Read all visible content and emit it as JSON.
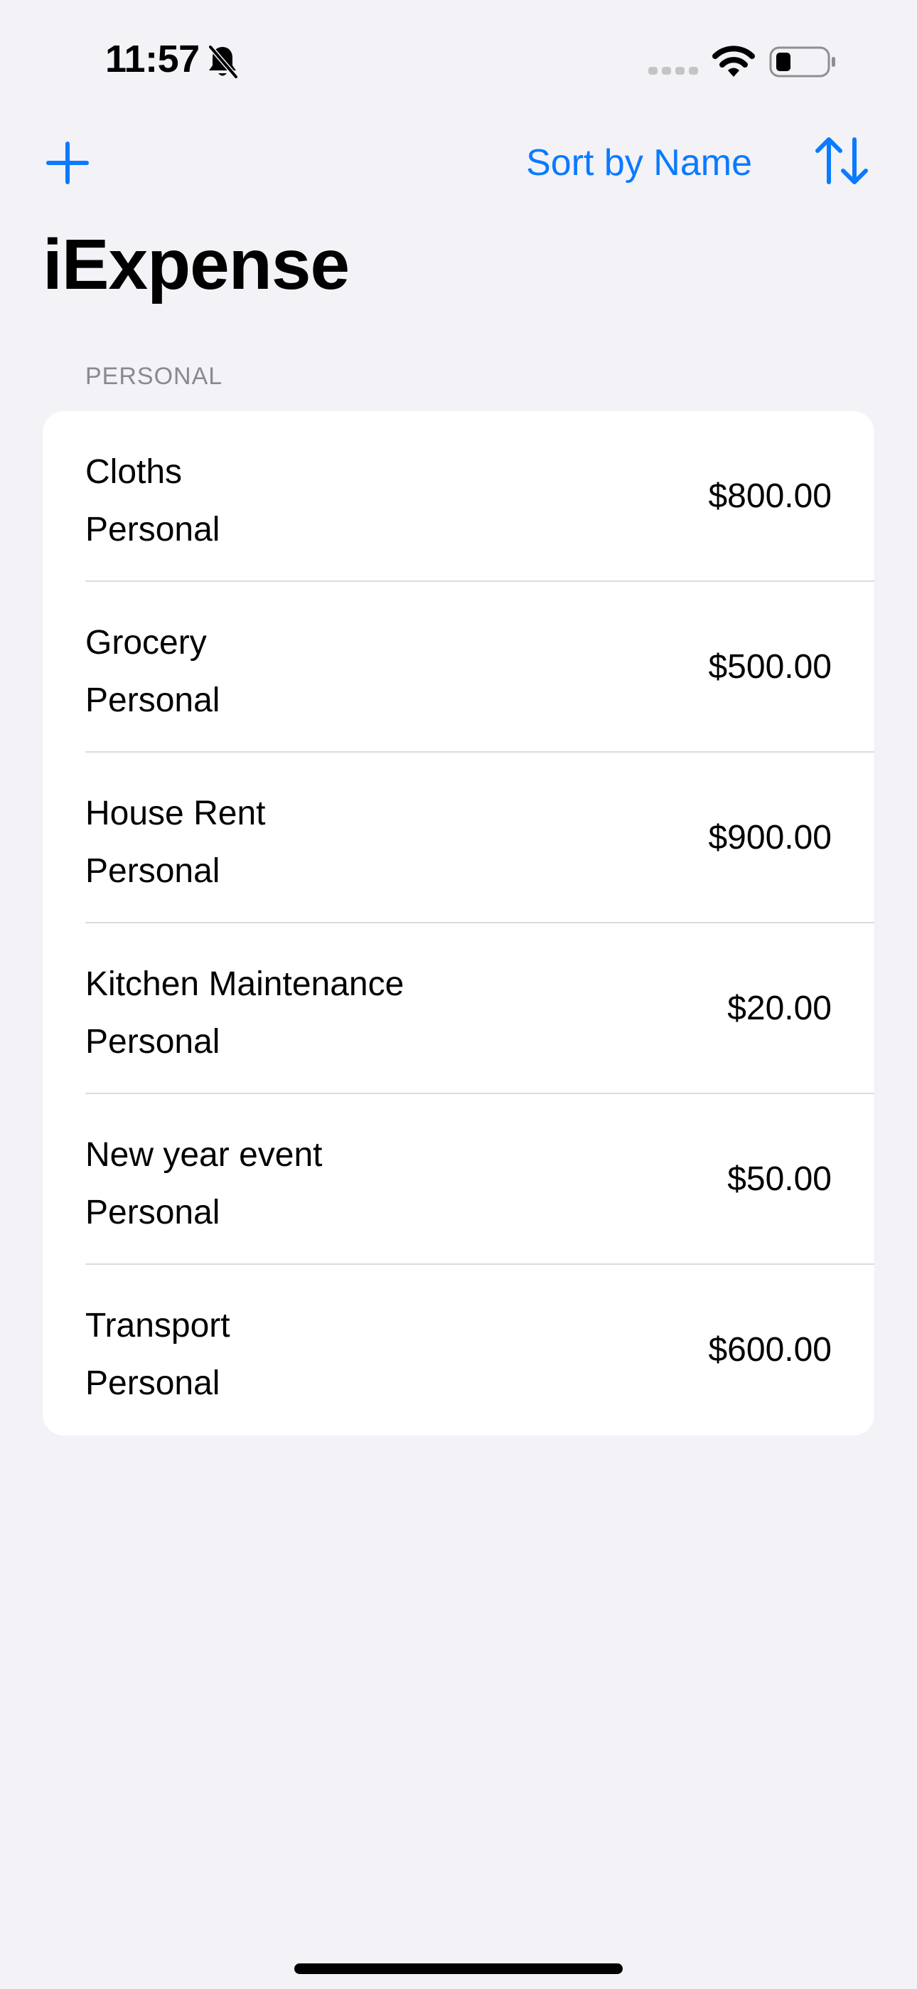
{
  "status_bar": {
    "time": "11:57",
    "icons": [
      "bell-slash-icon",
      "cellular-signal-icon",
      "wifi-icon",
      "battery-icon"
    ]
  },
  "nav": {
    "add_icon": "plus-icon",
    "sort_label": "Sort by Name",
    "sort_order_icon": "sort-up-down-arrows-icon",
    "title": "iExpense"
  },
  "section": {
    "header": "PERSONAL",
    "items": [
      {
        "name": "Cloths",
        "type": "Personal",
        "amount": "$800.00"
      },
      {
        "name": "Grocery",
        "type": "Personal",
        "amount": "$500.00"
      },
      {
        "name": "House Rent",
        "type": "Personal",
        "amount": "$900.00"
      },
      {
        "name": "Kitchen Maintenance",
        "type": "Personal",
        "amount": "$20.00"
      },
      {
        "name": "New year event",
        "type": "Personal",
        "amount": "$50.00"
      },
      {
        "name": "Transport",
        "type": "Personal",
        "amount": "$600.00"
      }
    ]
  },
  "colors": {
    "accent": "#0a7aff",
    "background": "#f2f2f7",
    "card": "#ffffff",
    "secondary_text": "#8a8a8e"
  }
}
